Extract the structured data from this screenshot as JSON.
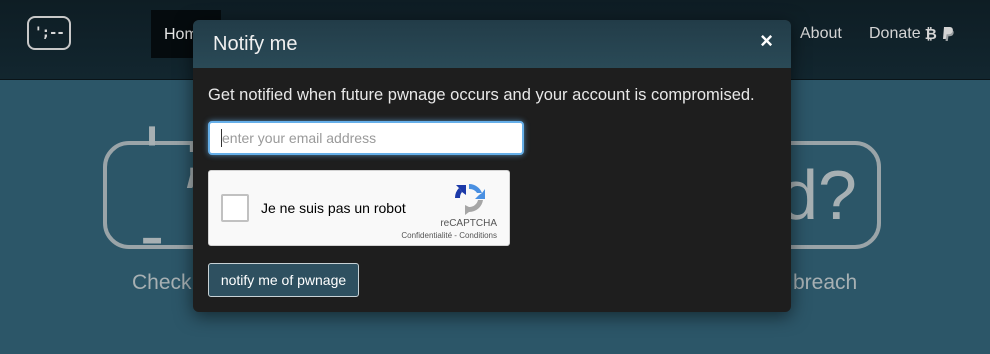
{
  "nav": {
    "logo": "';--",
    "home": "Home",
    "about": "About",
    "donate": "Donate",
    "donate_icons": [
      "bitcoin-icon",
      "paypal-icon"
    ]
  },
  "hero": {
    "left_logo": "';--",
    "right_text": "d?",
    "check_text": "Check",
    "breach_text": "breach"
  },
  "modal": {
    "title": "Notify me",
    "close": "×",
    "description": "Get notified when future pwnage occurs and your account is compromised.",
    "email_placeholder": "enter your email address",
    "email_value": "",
    "recaptcha": {
      "label": "Je ne suis pas un robot",
      "brand": "reCAPTCHA",
      "privacy": "Confidentialité",
      "separator": " - ",
      "terms": "Conditions"
    },
    "submit": "notify me of pwnage"
  },
  "colors": {
    "background": "#2c5668",
    "modal_bg": "#1e1e1e",
    "modal_header": "#2a4a57",
    "button": "#2e5060",
    "input_focus": "#66afe9"
  }
}
